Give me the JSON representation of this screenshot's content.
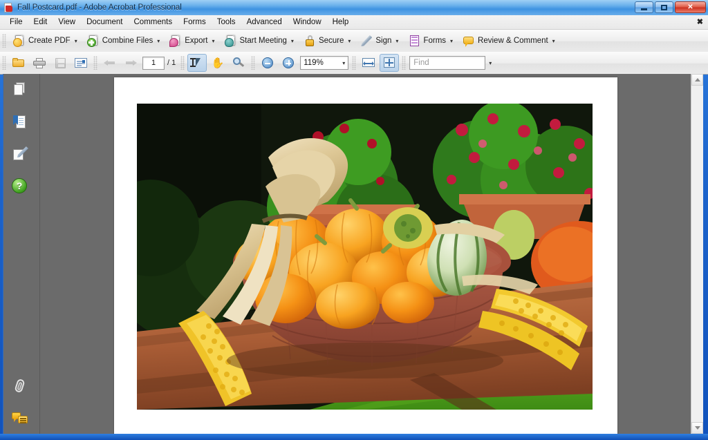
{
  "window": {
    "title": "Fall Postcard.pdf - Adobe Acrobat Professional",
    "doc_icon": "pdf-document-icon",
    "minimize_label": "Minimize",
    "maximize_label": "Maximize",
    "close_label": "✕",
    "document_close_label": "✖"
  },
  "menubar": {
    "items": [
      {
        "label": "File"
      },
      {
        "label": "Edit"
      },
      {
        "label": "View"
      },
      {
        "label": "Document"
      },
      {
        "label": "Comments"
      },
      {
        "label": "Forms"
      },
      {
        "label": "Tools"
      },
      {
        "label": "Advanced"
      },
      {
        "label": "Window"
      },
      {
        "label": "Help"
      }
    ]
  },
  "toolbar_tasks": {
    "items": [
      {
        "label": "Create PDF",
        "icon": "create-pdf-icon",
        "caret": "▾"
      },
      {
        "label": "Combine Files",
        "icon": "combine-files-icon",
        "caret": "▾"
      },
      {
        "label": "Export",
        "icon": "export-icon",
        "caret": "▾"
      },
      {
        "label": "Start Meeting",
        "icon": "start-meeting-icon",
        "caret": "▾"
      },
      {
        "label": "Secure",
        "icon": "secure-lock-icon",
        "caret": "▾"
      },
      {
        "label": "Sign",
        "icon": "sign-pen-icon",
        "caret": "▾"
      },
      {
        "label": "Forms",
        "icon": "forms-icon",
        "caret": "▾"
      },
      {
        "label": "Review & Comment",
        "icon": "review-comment-icon",
        "caret": "▾"
      }
    ]
  },
  "toolbar_nav": {
    "open_icon": "open-folder-icon",
    "print_icon": "print-icon",
    "save_icon": "save-disk-icon",
    "email_icon": "email-icon",
    "prev_icon": "previous-page-arrow-icon",
    "next_icon": "next-page-arrow-icon",
    "page_number": "1",
    "page_total": "/ 1",
    "select_tool_icon": "select-text-tool-icon",
    "hand_tool_icon": "hand-tool-icon",
    "marquee_zoom_icon": "marquee-zoom-icon",
    "zoom_out_icon": "zoom-out-icon",
    "zoom_in_icon": "zoom-in-icon",
    "zoom_value": "119%",
    "zoom_caret": "▾",
    "fit_width_icon": "fit-width-icon",
    "fit_page_icon": "fit-page-icon",
    "find_placeholder": "Find",
    "find_value": "",
    "find_caret": "▾"
  },
  "navigation_pane": {
    "items": [
      {
        "name": "pages-panel",
        "icon": "pages-icon"
      },
      {
        "name": "bookmarks-panel",
        "icon": "bookmarks-icon"
      },
      {
        "name": "signatures-panel",
        "icon": "signatures-icon"
      },
      {
        "name": "how-to-panel",
        "icon": "help-question-icon",
        "glyph": "?"
      },
      {
        "name": "attachments-panel",
        "icon": "paperclip-icon"
      },
      {
        "name": "comments-panel",
        "icon": "comments-bubbles-icon"
      }
    ]
  },
  "document": {
    "page_background": "#ffffff",
    "workspace_background": "#6b6b6b",
    "photo_alt": "Fall harvest photo: wicker basket of orange mini pumpkins and striped gourds with dried corn husks, ears of corn on a wooden picnic table, potted red and pink chrysanthemums and green grass in the background"
  },
  "colors": {
    "title_bar": "#6cb2ec",
    "window_frame": "#1152bb",
    "toolbar": "#ededed",
    "workspace": "#6b6b6b",
    "active_tool_highlight": "#b9d2ea",
    "close_button": "#cc3322"
  }
}
